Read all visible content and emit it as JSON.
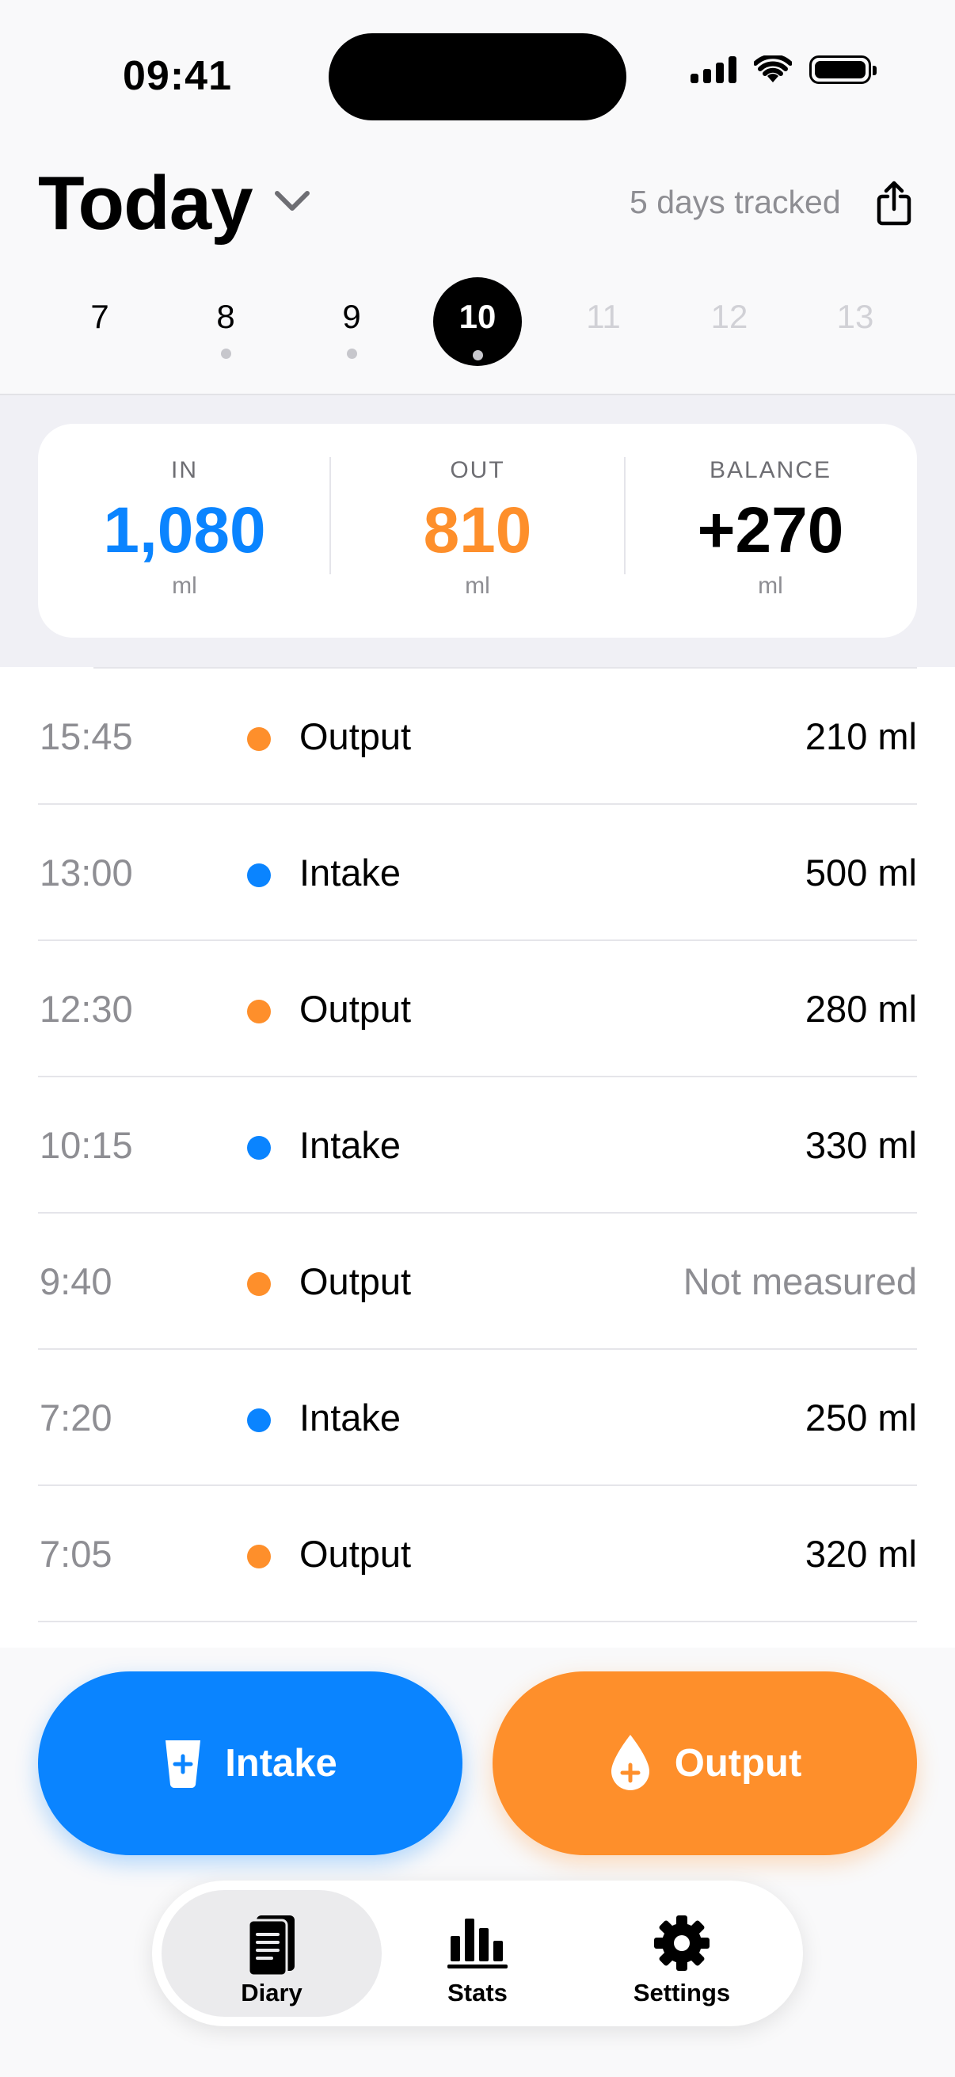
{
  "status_bar": {
    "time": "09:41"
  },
  "header": {
    "title": "Today",
    "tracked_text": "5 days tracked"
  },
  "days": [
    {
      "label": "7",
      "has_entries": false,
      "selected": false,
      "future": false
    },
    {
      "label": "8",
      "has_entries": true,
      "selected": false,
      "future": false
    },
    {
      "label": "9",
      "has_entries": true,
      "selected": false,
      "future": false
    },
    {
      "label": "10",
      "has_entries": true,
      "selected": true,
      "future": false
    },
    {
      "label": "11",
      "has_entries": false,
      "selected": false,
      "future": true
    },
    {
      "label": "12",
      "has_entries": false,
      "selected": false,
      "future": true
    },
    {
      "label": "13",
      "has_entries": false,
      "selected": false,
      "future": true
    }
  ],
  "summary": {
    "in": {
      "label": "IN",
      "value": "1,080",
      "unit": "ml",
      "color": "#0a84ff"
    },
    "out": {
      "label": "OUT",
      "value": "810",
      "unit": "ml",
      "color": "#fe8f2b"
    },
    "balance": {
      "label": "BALANCE",
      "value": "+270",
      "unit": "ml",
      "color": "#000000"
    }
  },
  "entries": [
    {
      "time": "15:45",
      "type": "Output",
      "amount": "210 ml",
      "measured": true
    },
    {
      "time": "13:00",
      "type": "Intake",
      "amount": "500 ml",
      "measured": true
    },
    {
      "time": "12:30",
      "type": "Output",
      "amount": "280 ml",
      "measured": true
    },
    {
      "time": "10:15",
      "type": "Intake",
      "amount": "330 ml",
      "measured": true
    },
    {
      "time": "9:40",
      "type": "Output",
      "amount": "Not measured",
      "measured": false
    },
    {
      "time": "7:20",
      "type": "Intake",
      "amount": "250 ml",
      "measured": true
    },
    {
      "time": "7:05",
      "type": "Output",
      "amount": "320 ml",
      "measured": true
    }
  ],
  "colors": {
    "intake": "#0a84ff",
    "output": "#fe8f2b"
  },
  "actions": {
    "intake_label": "Intake",
    "output_label": "Output",
    "intake_icon": "cup-plus-icon",
    "output_icon": "drop-plus-icon"
  },
  "tabs": [
    {
      "label": "Diary",
      "icon": "diary-icon",
      "active": true
    },
    {
      "label": "Stats",
      "icon": "stats-icon",
      "active": false
    },
    {
      "label": "Settings",
      "icon": "gear-icon",
      "active": false
    }
  ]
}
